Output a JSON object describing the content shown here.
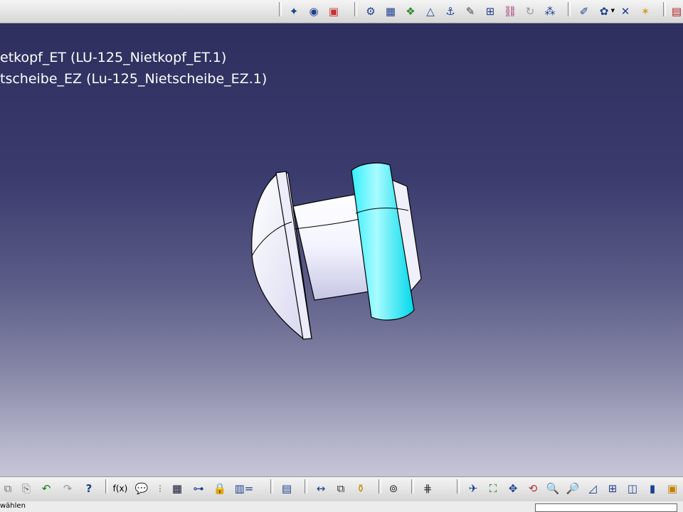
{
  "viewport": {
    "spec_tree_lines": [
      "etkopf_ET (LU-125_Nietkopf_ET.1)",
      "tscheibe_EZ (Lu-125_Nietscheibe_EZ.1)"
    ],
    "background_gradient": [
      "#2c2d5c",
      "#d6d6e2"
    ],
    "highlight_color": "#00e5f2"
  },
  "top_toolbar": {
    "icons": [
      "catalog-icon",
      "material-icon",
      "apply-material-icon",
      "product-icon",
      "part-icon",
      "component-icon",
      "measure-icon",
      "anchor-icon",
      "pencil-icon",
      "constraint-icon",
      "link-icon",
      "update-icon",
      "multi-icon",
      "sketch-icon",
      "gear-icon",
      "compass-icon",
      "snap-icon",
      "product-switch-icon"
    ]
  },
  "bottom_toolbar": {
    "icons": [
      "copy-icon",
      "paste-icon",
      "undo-icon",
      "redo-icon",
      "whats-this-icon",
      "formula-icon",
      "comment-icon",
      "knowledge-icon",
      "table-icon",
      "tree-icon",
      "lock-icon",
      "parameter-icon",
      "catalog-browser-icon",
      "measure-between-icon",
      "measure-item-icon",
      "mass-icon",
      "refresh-icon",
      "axis-system-icon",
      "fly-icon",
      "fit-all-icon",
      "pan-icon",
      "rotate-icon",
      "zoom-in-icon",
      "zoom-out-icon",
      "normal-view-icon",
      "multi-view-icon",
      "iso-view-icon",
      "shading-icon",
      "hide-show-icon"
    ],
    "undo_glyph": "↶",
    "redo_glyph": "↷",
    "whats_this_glyph": "?",
    "formula_glyph": "f(x)"
  },
  "status_bar": {
    "text": "wählen",
    "input_value": ""
  }
}
